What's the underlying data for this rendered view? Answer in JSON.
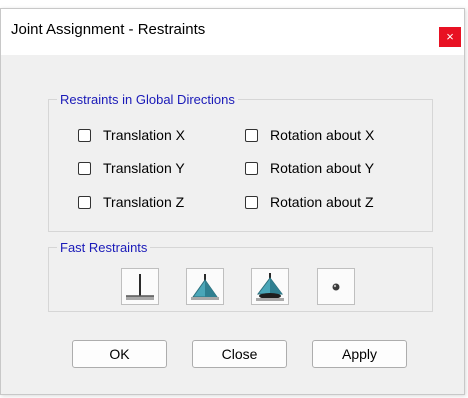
{
  "window": {
    "title": "Joint Assignment - Restraints",
    "close_glyph": "×",
    "close_color": "#e81123"
  },
  "restraints_group": {
    "legend": "Restraints in Global Directions",
    "legend_color": "#1a1ab8",
    "checkboxes": [
      {
        "label": "Translation  X",
        "checked": false
      },
      {
        "label": "Translation  Y",
        "checked": false
      },
      {
        "label": "Translation  Z",
        "checked": false
      },
      {
        "label": "Rotation about  X",
        "checked": false
      },
      {
        "label": "Rotation about  Y",
        "checked": false
      },
      {
        "label": "Rotation about  Z",
        "checked": false
      }
    ]
  },
  "fast_restraints": {
    "legend": "Fast Restraints",
    "buttons": [
      {
        "icon": "fixed-support-icon"
      },
      {
        "icon": "pinned-support-icon"
      },
      {
        "icon": "roller-support-icon"
      },
      {
        "icon": "free-joint-icon"
      }
    ]
  },
  "buttons": {
    "ok": "OK",
    "close": "Close",
    "apply": "Apply"
  }
}
